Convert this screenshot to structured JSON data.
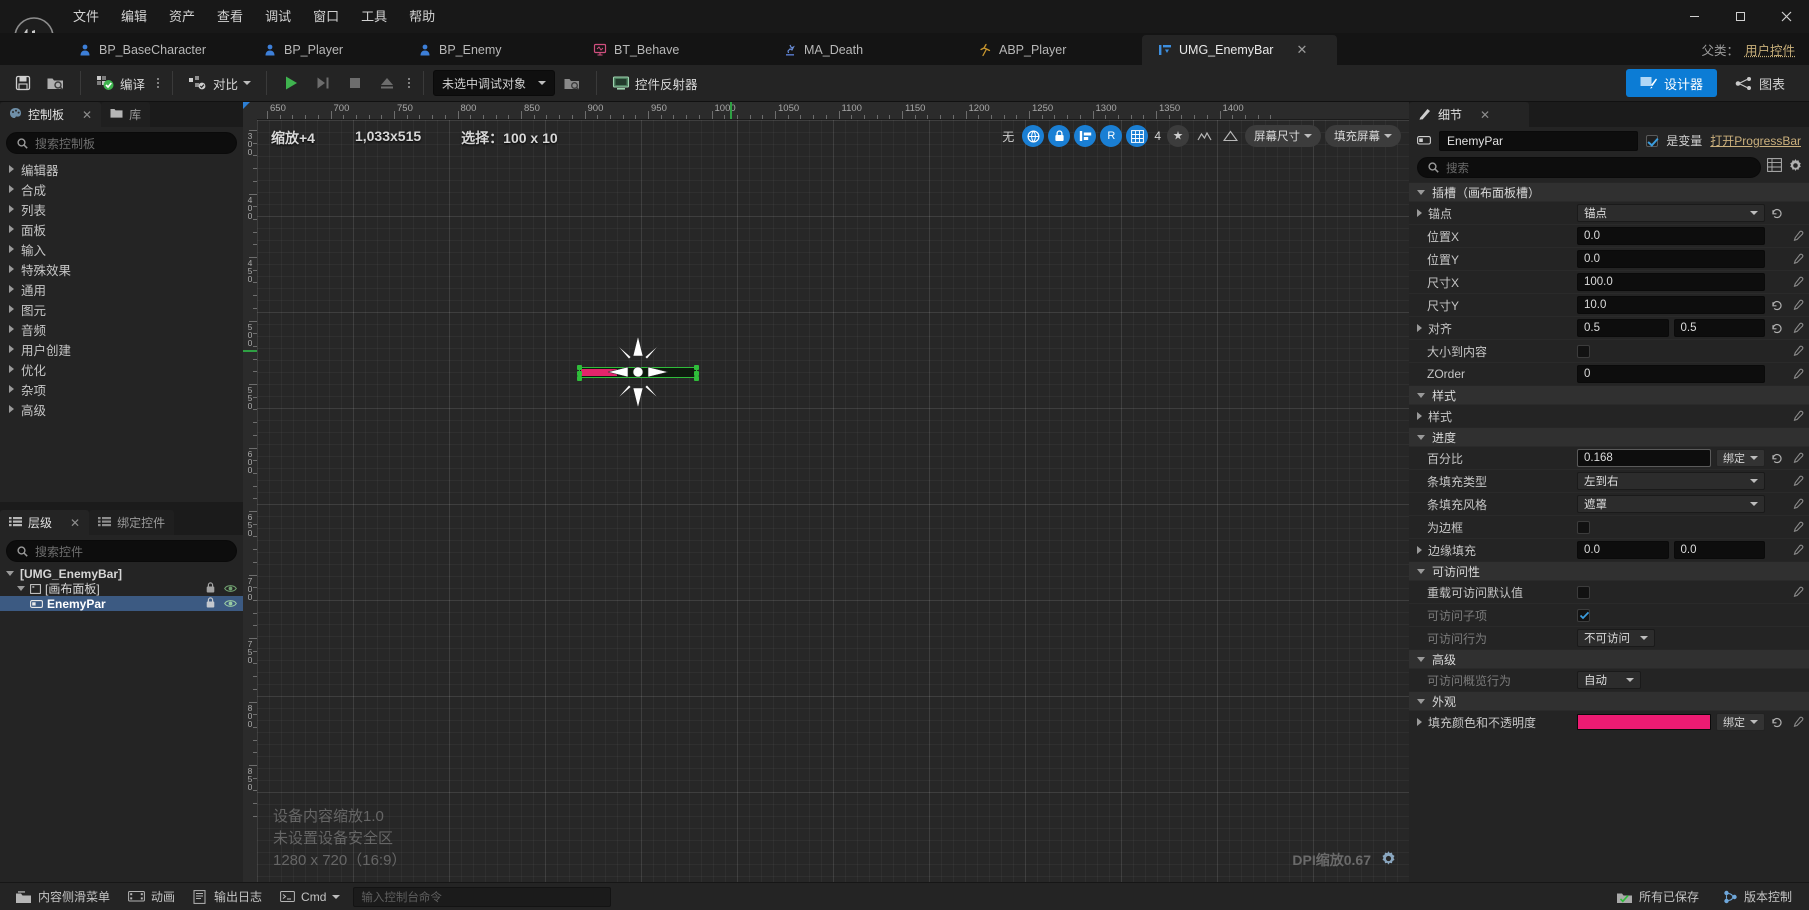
{
  "window": {
    "minimize": "—",
    "maximize": "▢",
    "close": "✕"
  },
  "menu": {
    "items": [
      "文件",
      "编辑",
      "资产",
      "查看",
      "调试",
      "窗口",
      "工具",
      "帮助"
    ]
  },
  "tabs": {
    "items": [
      {
        "label": "BP_BaseCharacter",
        "icon": "blueprint-character-icon",
        "active": false
      },
      {
        "label": "BP_Player",
        "icon": "blueprint-character-icon",
        "active": false
      },
      {
        "label": "BP_Enemy",
        "icon": "blueprint-character-icon",
        "active": false
      },
      {
        "label": "BT_Behave",
        "icon": "behavior-tree-icon",
        "active": false
      },
      {
        "label": "MA_Death",
        "icon": "montage-icon",
        "active": false
      },
      {
        "label": "ABP_Player",
        "icon": "anim-blueprint-icon",
        "active": false
      },
      {
        "label": "UMG_EnemyBar",
        "icon": "widget-blueprint-icon",
        "active": true
      }
    ],
    "close_glyph": "✕",
    "parent_class_label": "父类：",
    "parent_class_value": "用户控件"
  },
  "toolbar": {
    "save_tip": "save-icon",
    "browse_tip": "browse-icon",
    "compile_label": "编译",
    "diff_label": "对比",
    "play_label": "play",
    "debug_target_label": "未选中调试对象",
    "widget_reflector_label": "控件反射器",
    "designer_label": "设计器",
    "graph_label": "图表"
  },
  "palette": {
    "tabs": [
      {
        "label": "控制板",
        "icon": "palette-icon",
        "active": true
      },
      {
        "label": "库",
        "icon": "folder-icon",
        "active": false
      }
    ],
    "close_glyph": "✕",
    "search_placeholder": "搜索控制板",
    "categories": [
      "编辑器",
      "合成",
      "列表",
      "面板",
      "输入",
      "特殊效果",
      "通用",
      "图元",
      "音频",
      "用户创建",
      "优化",
      "杂项",
      "高级"
    ]
  },
  "hierarchy": {
    "tabs": [
      {
        "label": "层级",
        "icon": "list-icon",
        "active": true
      },
      {
        "label": "绑定控件",
        "icon": "list-icon",
        "active": false
      }
    ],
    "close_glyph": "✕",
    "search_placeholder": "搜索控件",
    "tree": [
      {
        "label": "[UMG_EnemyBar]",
        "depth": 0,
        "expanded": true,
        "selected": false,
        "icon": "none",
        "lock": false,
        "eye": false
      },
      {
        "label": "[画布面板]",
        "depth": 1,
        "expanded": true,
        "selected": false,
        "icon": "canvas-panel-icon",
        "lock": true,
        "eye": true
      },
      {
        "label": "EnemyPar",
        "depth": 2,
        "expanded": false,
        "selected": true,
        "icon": "progress-bar-icon",
        "lock": true,
        "eye": true
      }
    ]
  },
  "viewport": {
    "zoom_label": "缩放+4",
    "resolution_label": "1,033x515",
    "selection_label": "选择：100 x 10",
    "no_label": "无",
    "r_label": "R",
    "snap_value": "4",
    "screen_size_label": "屏幕尺寸",
    "fill_screen_label": "填充屏幕",
    "ruler_h_labels": [
      "650",
      "700",
      "750",
      "800",
      "850",
      "900",
      "950",
      "1000",
      "1050",
      "1100",
      "1150",
      "1200",
      "1250",
      "1300",
      "1350",
      "1400"
    ],
    "ruler_v_labels": [
      "3 0 0",
      "4 0 0",
      "4 5 0",
      "5 0 0",
      "5 5 0",
      "6 0 0",
      "6 5 0",
      "7 0 0",
      "7 5 0",
      "8 0 0",
      "8 5 0"
    ],
    "overlay_lines": [
      "设备内容缩放1.0",
      "未设置设备安全区",
      "1280 x 720（16:9）"
    ],
    "dpi_label": "DPI缩放0.67",
    "progress_percent": 0.168,
    "fill_color": "#e3256b",
    "border_color": "#2fbd3a"
  },
  "details": {
    "tab_label": "细节",
    "close_glyph": "✕",
    "widget_name": "EnemyPar",
    "is_variable_label": "是变量",
    "is_variable_checked": true,
    "open_parent_label": "打开ProgressBar",
    "search_placeholder": "搜索",
    "sections": [
      {
        "title": "插槽（画布面板槽）",
        "rows": [
          {
            "label": "锚点",
            "type": "select",
            "value": "锚点",
            "arrow": true,
            "revert": true,
            "eyedrop": false
          },
          {
            "label": "位置X",
            "type": "text",
            "value": "0.0",
            "eyedrop": true
          },
          {
            "label": "位置Y",
            "type": "text",
            "value": "0.0",
            "eyedrop": true
          },
          {
            "label": "尺寸X",
            "type": "text",
            "value": "100.0",
            "eyedrop": true
          },
          {
            "label": "尺寸Y",
            "type": "text",
            "value": "10.0",
            "revert": true,
            "eyedrop": true
          },
          {
            "label": "对齐",
            "type": "text2",
            "value": "0.5",
            "value2": "0.5",
            "arrow": true,
            "revert": true,
            "eyedrop": true
          },
          {
            "label": "大小到内容",
            "type": "checkbox",
            "value": "",
            "eyedrop": true
          },
          {
            "label": "ZOrder",
            "type": "text",
            "value": "0",
            "eyedrop": true
          }
        ]
      },
      {
        "title": "样式",
        "rows": [
          {
            "label": "样式",
            "type": "empty",
            "value": "",
            "arrow": true,
            "eyedrop": true
          }
        ]
      },
      {
        "title": "进度",
        "rows": [
          {
            "label": "百分比",
            "type": "text",
            "value": "0.168",
            "bind": "绑定",
            "revert": true,
            "eyedrop": false,
            "indent": true,
            "focus": true
          },
          {
            "label": "条填充类型",
            "type": "select",
            "value": "左到右",
            "eyedrop": true
          },
          {
            "label": "条填充风格",
            "type": "select",
            "value": "遮罩",
            "eyedrop": true
          },
          {
            "label": "为边框",
            "type": "checkbox",
            "value": "",
            "eyedrop": true
          },
          {
            "label": "边缘填充",
            "type": "text2",
            "value": "0.0",
            "value2": "0.0",
            "arrow": true,
            "eyedrop": true
          }
        ]
      },
      {
        "title": "可访问性",
        "rows": [
          {
            "label": "重载可访问默认值",
            "type": "checkbox",
            "value": "",
            "eyedrop": true
          },
          {
            "label": "可访问子项",
            "type": "checkbox-checked",
            "value": "",
            "dim": true
          },
          {
            "label": "可访问行为",
            "type": "select-small",
            "value": "不可访问",
            "dim": true
          }
        ]
      },
      {
        "title": "高级",
        "rows": [
          {
            "label": "可访问概览行为",
            "type": "select-small",
            "value": "自动",
            "dim": true
          }
        ]
      },
      {
        "title": "外观",
        "rows": [
          {
            "label": "填充颜色和不透明度",
            "type": "color",
            "value": "#ec1b72",
            "bind": "绑定",
            "arrow": true,
            "revert": true,
            "eyedrop": true
          }
        ]
      }
    ]
  },
  "status": {
    "content_drawer_label": "内容侧滑菜单",
    "animation_label": "动画",
    "output_log_label": "输出日志",
    "cmd_label": "Cmd",
    "cmd_placeholder": "输入控制台命令",
    "all_saved_label": "所有已保存",
    "source_control_label": "版本控制"
  }
}
